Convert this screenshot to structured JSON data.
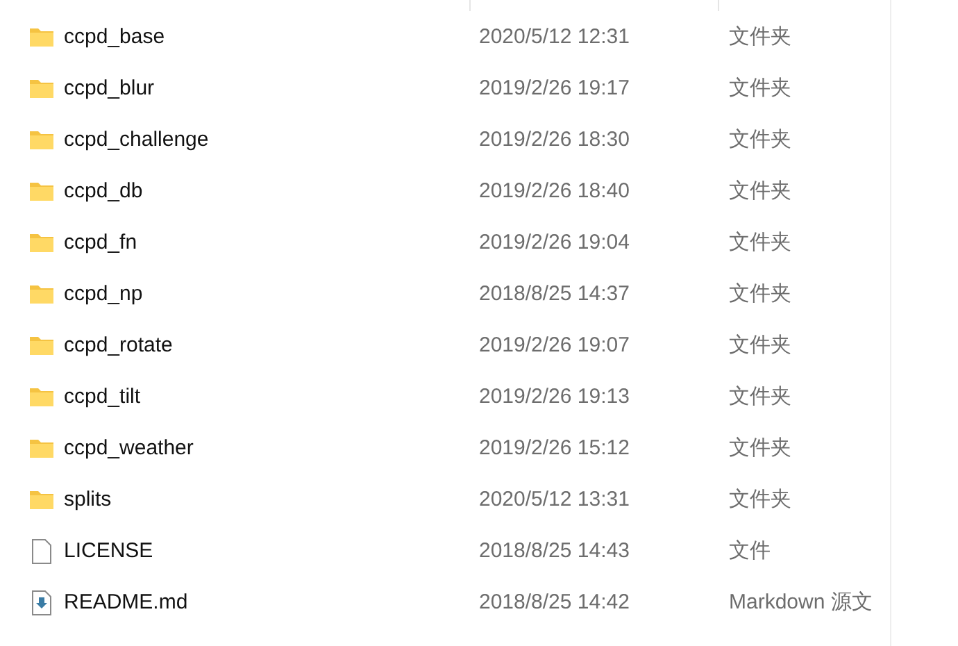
{
  "files": [
    {
      "kind": "folder",
      "name": "ccpd_base",
      "modified": "2020/5/12 12:31",
      "type": "文件夹"
    },
    {
      "kind": "folder",
      "name": "ccpd_blur",
      "modified": "2019/2/26 19:17",
      "type": "文件夹"
    },
    {
      "kind": "folder",
      "name": "ccpd_challenge",
      "modified": "2019/2/26 18:30",
      "type": "文件夹"
    },
    {
      "kind": "folder",
      "name": "ccpd_db",
      "modified": "2019/2/26 18:40",
      "type": "文件夹"
    },
    {
      "kind": "folder",
      "name": "ccpd_fn",
      "modified": "2019/2/26 19:04",
      "type": "文件夹"
    },
    {
      "kind": "folder",
      "name": "ccpd_np",
      "modified": "2018/8/25 14:37",
      "type": "文件夹"
    },
    {
      "kind": "folder",
      "name": "ccpd_rotate",
      "modified": "2019/2/26 19:07",
      "type": "文件夹"
    },
    {
      "kind": "folder",
      "name": "ccpd_tilt",
      "modified": "2019/2/26 19:13",
      "type": "文件夹"
    },
    {
      "kind": "folder",
      "name": "ccpd_weather",
      "modified": "2019/2/26 15:12",
      "type": "文件夹"
    },
    {
      "kind": "folder",
      "name": "splits",
      "modified": "2020/5/12 13:31",
      "type": "文件夹"
    },
    {
      "kind": "file",
      "name": "LICENSE",
      "modified": "2018/8/25 14:43",
      "type": "文件"
    },
    {
      "kind": "markdown",
      "name": "README.md",
      "modified": "2018/8/25 14:42",
      "type": "Markdown 源文"
    }
  ]
}
